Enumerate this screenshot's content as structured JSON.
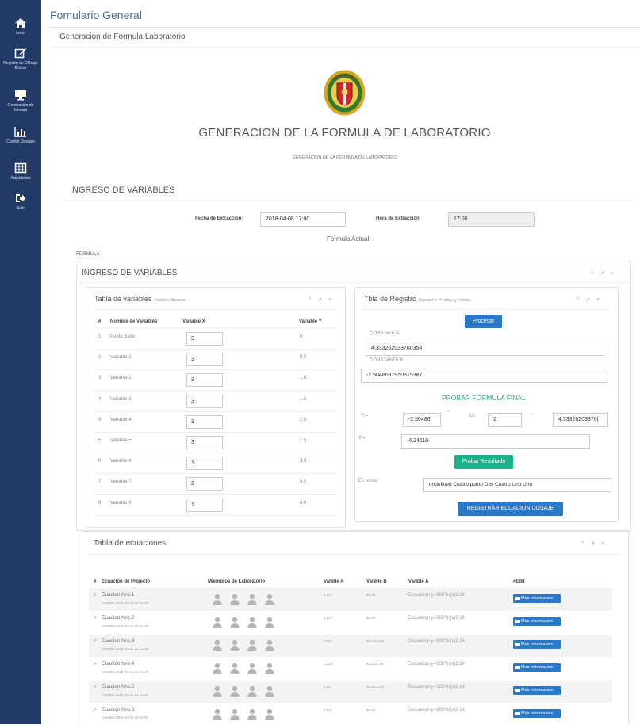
{
  "sidebar": {
    "items": [
      {
        "label": "Inicio",
        "icon": "home-icon"
      },
      {
        "label": "Registro de DOsaje Etilicio",
        "icon": "edit-icon"
      },
      {
        "label": "Generacion de formula",
        "icon": "monitor-icon"
      },
      {
        "label": "Control Dosajes",
        "icon": "bar-chart-icon"
      },
      {
        "label": "Actividades",
        "icon": "calendar-grid-icon"
      },
      {
        "label": "Salir",
        "icon": "sign-out-icon"
      }
    ]
  },
  "page": {
    "title": "Fomulario General",
    "panel_title": "Generacion de Formula Laboratorio",
    "heading": "GENERACION DE LA FORMULA DE LABORATORIO",
    "subheading": "GENERACION DE LA FORMULA DE LABORATORIO"
  },
  "ingreso": {
    "title": "INGRESO DE VARIABLES",
    "fecha_label": "Fecha de Extraccion:",
    "fecha_value": "2018-04-08 17:00",
    "hora_label": "Hora de Extraccion:",
    "hora_value": "17:00",
    "formula_actual": "Formula Actual",
    "formula_label": "FORMULA",
    "inner_title": "INGRESO DE VARIABLES",
    "tools": "^ ↗ ×"
  },
  "tabla_variables": {
    "title": "Tabla de variables",
    "subtitle": "Variables Basicas",
    "headers": [
      "#",
      "Nombre de Variables",
      "Variable X",
      "Variable Y"
    ],
    "rows": [
      {
        "n": "1",
        "name": "Punto Base",
        "x": "3",
        "y": "0"
      },
      {
        "n": "2",
        "name": "Variable 1",
        "x": "3",
        "y": "0.5"
      },
      {
        "n": "3",
        "name": "Variable 2",
        "x": "3",
        "y": "1.0"
      },
      {
        "n": "4",
        "name": "Variable 3",
        "x": "3",
        "y": "1.5"
      },
      {
        "n": "4",
        "name": "Variable 4",
        "x": "3",
        "y": "2.0"
      },
      {
        "n": "5",
        "name": "Variable 5",
        "x": "3",
        "y": "2.5"
      },
      {
        "n": "6",
        "name": "Variable 6",
        "x": "3",
        "y": "3.0"
      },
      {
        "n": "7",
        "name": "Variable 7",
        "x": "2",
        "y": "3.5"
      },
      {
        "n": "8",
        "name": "Variable 8",
        "x": "1",
        "y": "4.0"
      }
    ]
  },
  "tabla_registro": {
    "title": "Tbla de Registro",
    "subtitle": "Ingresod e Pruebas y registro",
    "procesar": "Procesar",
    "constante_a_label": "CONSTATE A",
    "constante_a": "4.333262033760354",
    "constante_b_label": "CONSTANTE B",
    "constante_b": "-2.5048637950315387",
    "probar_heading": "PROBAR FORMULA FINAL",
    "y_label": "Y =",
    "coef_value": "-2.50486",
    "times": "*",
    "ln_label": "Ln",
    "ln_value": "2",
    "minus": "-",
    "const_value": "4.33326203376(",
    "y2_label": "Y =",
    "result_value": "-4.24110",
    "probar_btn": "Probar Resultado",
    "letras_label": "En letras:",
    "letras_value": "undefined Cuatro punto Dos Cuatro Uno Uno",
    "registrar_btn": "REGISTRAR ECUACION DOSAJE"
  },
  "tabla_ecuaciones": {
    "title": "Tabla de ecuaciones",
    "headers": [
      "#",
      "Ecuacion de Projecto",
      "Miembros de Laboratorio",
      "Varible A",
      "Varible B",
      "Varible A",
      "#Edit"
    ],
    "rows": [
      {
        "hash": "#",
        "name": "Euacion Nro.1",
        "created": "Created 0000-00-00 00:00:00",
        "a": "4.417",
        "b": "98.82",
        "eq": "Eecuacion y=985*ln(x)2.14",
        "btn": "Mas Informacion"
      },
      {
        "hash": "#",
        "name": "Euacion Nro.2",
        "created": "Created 0000-00-00 00:00:00",
        "a": "4.417",
        "b": "98.82",
        "eq": "Eecuacion y=985*ln(x)2.14",
        "btn": "Mas Informacion"
      },
      {
        "hash": "#",
        "name": "Euacion Nro.3",
        "created": "Created 2018-03-31 21:23:00",
        "a": "6.661",
        "b": "98.821.242",
        "eq": "Eecuacion y=985*ln(x)2.14",
        "btn": "Mas Informacion"
      },
      {
        "hash": "#",
        "name": "Euacion Nro.4",
        "created": "Created 2018-03-31 21:05:00",
        "a": "2.446",
        "b": "98.82.6.32",
        "eq": "Eecuacion y=985*ln(x)2.14",
        "btn": "Mas Informacion"
      },
      {
        "hash": "#",
        "name": "Euacion Nro.5",
        "created": "Created 2018-03-31 21:22:00",
        "a": "4.26",
        "b": "98.822.231",
        "eq": "Eecuacion y=985*ln(x)2.14",
        "btn": "Mas Informacion"
      },
      {
        "hash": "#",
        "name": "Euacion Nro.6",
        "created": "Created 0000-00-00 00:00:00",
        "a": "4.417",
        "b": "98.82",
        "eq": "Eecuacion y=985*ln(x)2.14",
        "btn": "Mas Informacion"
      }
    ]
  }
}
